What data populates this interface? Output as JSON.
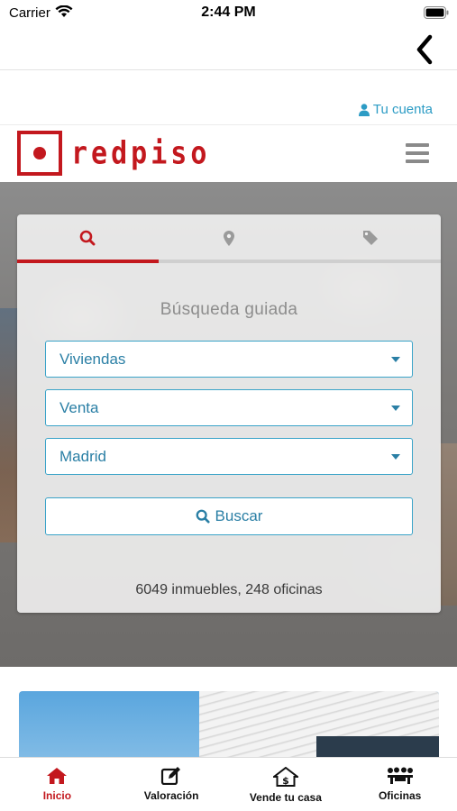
{
  "status_bar": {
    "carrier": "Carrier",
    "time": "2:44 PM"
  },
  "account": {
    "label": "Tu cuenta",
    "icon": "user-icon",
    "color": "#2d9cc5"
  },
  "brand": {
    "name": "redpiso",
    "color": "#c3181e"
  },
  "search": {
    "tabs": [
      {
        "icon": "search-icon",
        "active": true
      },
      {
        "icon": "map-marker-icon",
        "active": false
      },
      {
        "icon": "tag-icon",
        "active": false
      }
    ],
    "title": "Búsqueda guiada",
    "property_type": "Viviendas",
    "operation": "Venta",
    "location": "Madrid",
    "button_label": "Buscar",
    "stats": "6049 inmuebles, 248 oficinas"
  },
  "tab_bar": {
    "items": [
      {
        "label": "Inicio",
        "icon": "home-icon",
        "active": true
      },
      {
        "label": "Valoración",
        "icon": "edit-icon",
        "active": false
      },
      {
        "label": "Vende tu casa",
        "icon": "house-dollar-icon",
        "active": false
      },
      {
        "label": "Oficinas",
        "icon": "office-meeting-icon",
        "active": false
      }
    ]
  },
  "colors": {
    "accent": "#c3181e",
    "link": "#2a7fa5",
    "border": "#3aa3c8"
  }
}
